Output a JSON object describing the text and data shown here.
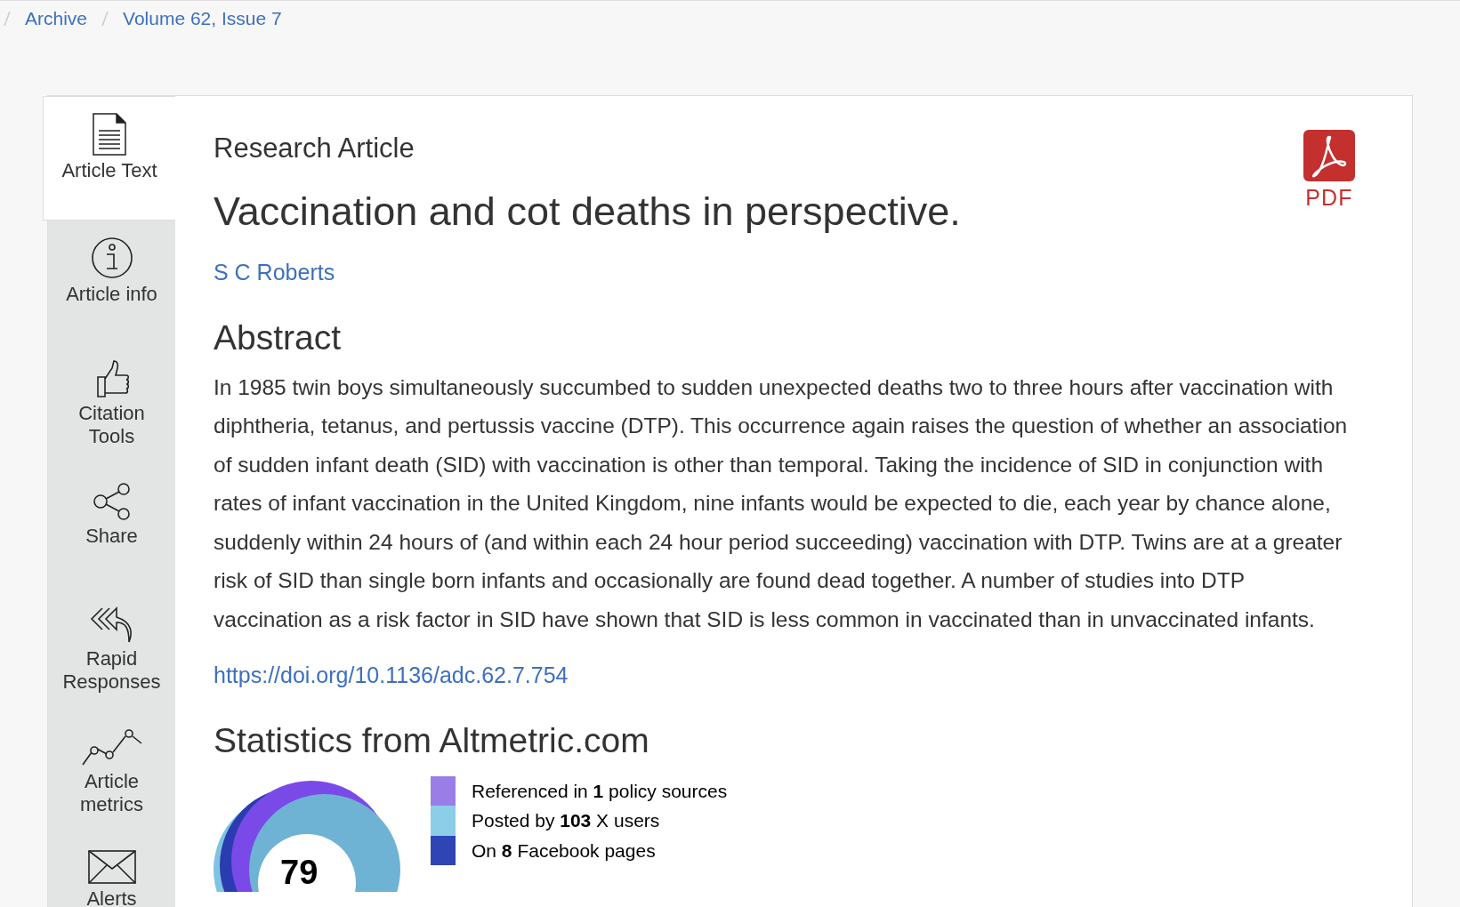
{
  "breadcrumb": [
    {
      "label": "Archive"
    },
    {
      "label": "Volume 62, Issue 7"
    }
  ],
  "sidebar": {
    "items": [
      {
        "label": "Article Text",
        "kind": "document",
        "selected": true
      },
      {
        "label": "Article info",
        "kind": "info",
        "selected": false
      },
      {
        "label": "Citation Tools",
        "kind": "thumb",
        "selected": false
      },
      {
        "label": "Share",
        "kind": "share",
        "selected": false
      },
      {
        "label": "Rapid Responses",
        "kind": "reply",
        "selected": false
      },
      {
        "label": "Article metrics",
        "kind": "metrics",
        "selected": false
      },
      {
        "label": "Alerts",
        "kind": "mail",
        "selected": false
      }
    ]
  },
  "article": {
    "type": "Research Article",
    "title": "Vaccination and cot deaths in perspective.",
    "authors": "S C Roberts",
    "pdf_label": "PDF",
    "abstract_heading": "Abstract",
    "abstract": "In 1985 twin boys simultaneously succumbed to sudden unexpected deaths two to three hours after vaccination with diphtheria, tetanus, and pertussis vaccine (DTP). This occurrence again raises the question of whether an association of sudden infant death (SID) with vaccination is other than temporal. Taking the incidence of SID in conjunction with rates of infant vaccination in the United Kingdom, nine infants would be expected to die, each year by chance alone, suddenly within 24 hours of (and within each 24 hour period succeeding) vaccination with DTP. Twins are at a greater risk of SID than single born infants and occasionally are found dead together. A number of studies into DTP vaccination as a risk factor in SID have shown that SID is less common in vaccinated than in unvaccinated infants.",
    "doi": "https://doi.org/10.1136/adc.62.7.754"
  },
  "altmetric": {
    "heading": "Statistics from Altmetric.com",
    "score": "79",
    "legend": [
      {
        "text": "Referenced in **1** policy sources",
        "color": "#9b7de8"
      },
      {
        "text": "Posted by **103** X users",
        "color": "#8ccde8"
      },
      {
        "text": "On **8** Facebook pages",
        "color": "#2f45b5"
      }
    ]
  }
}
